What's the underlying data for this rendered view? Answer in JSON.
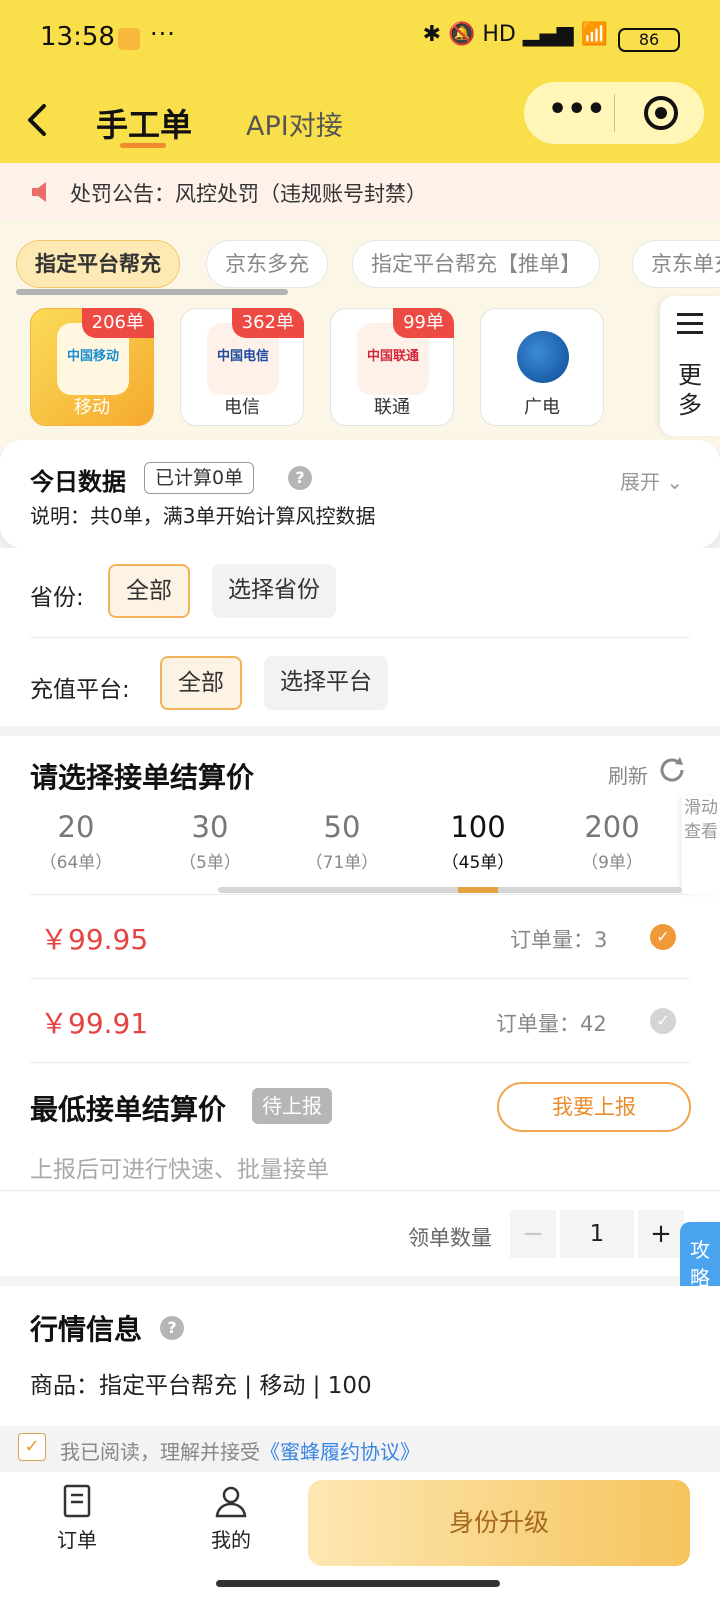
{
  "status": {
    "time": "13:58",
    "dots": "···",
    "icons_right": "✱ 🔕 HD ▂▄▆ 📶",
    "battery": "86"
  },
  "header": {
    "title": "手工单",
    "tab2": "API对接",
    "back_icon": "chevron-left-icon",
    "capsule_more": "•••"
  },
  "notice": {
    "text": "处罚公告：风控处罚（违规账号封禁）"
  },
  "chips": [
    {
      "label": "指定平台帮充",
      "active": true
    },
    {
      "label": "京东多充"
    },
    {
      "label": "指定平台帮充【推单】"
    },
    {
      "label": "京东单充"
    }
  ],
  "operators": [
    {
      "name": "移动",
      "badge": "206单",
      "logo_text": "中国移动",
      "color": "#1a8fd1"
    },
    {
      "name": "电信",
      "badge": "362单",
      "logo_text": "中国电信",
      "color": "#1c4a9e"
    },
    {
      "name": "联通",
      "badge": "99单",
      "logo_text": "中国联通",
      "color": "#d6283a"
    },
    {
      "name": "广电",
      "badge": ""
    }
  ],
  "more": {
    "label": "更多"
  },
  "stats": {
    "title": "今日数据",
    "badge": "已计算0单",
    "expand": "展开",
    "desc": "说明：共0单，满3单开始计算风控数据"
  },
  "filters": {
    "province_label": "省份:",
    "province_all": "全部",
    "province_select": "选择省份",
    "platform_label": "充值平台:",
    "platform_all": "全部",
    "platform_select": "选择平台"
  },
  "price": {
    "title": "请选择接单结算价",
    "refresh": "刷新",
    "slide_hint": "滑动查看",
    "denoms": [
      {
        "value": "20",
        "count": "（64单）"
      },
      {
        "value": "30",
        "count": "（5单）"
      },
      {
        "value": "50",
        "count": "（71单）"
      },
      {
        "value": "100",
        "count": "（45单）",
        "active": true
      },
      {
        "value": "200",
        "count": "（9单）"
      }
    ],
    "rows": [
      {
        "price": "￥99.95",
        "qty": "订单量：3",
        "selected": true
      },
      {
        "price": "￥99.91",
        "qty": "订单量：42",
        "selected": false
      }
    ]
  },
  "min_price": {
    "title": "最低接单结算价",
    "status": "待上报",
    "report_btn": "我要上报",
    "hint": "上报后可进行快速、批量接单"
  },
  "quantity": {
    "label": "领单数量",
    "value": "1",
    "minus": "−",
    "plus": "+"
  },
  "guide": {
    "label": "攻略",
    "arrow": "«"
  },
  "market": {
    "title": "行情信息",
    "goods": "商品：指定平台帮充 | 移动 | 100"
  },
  "agreement": {
    "checked": "✓",
    "text": "我已阅读，理解并接受",
    "link": "《蜜蜂履约协议》"
  },
  "bottom_nav": [
    {
      "label": "订单",
      "icon": "order-icon"
    },
    {
      "label": "我的",
      "icon": "person-icon"
    }
  ],
  "cta": {
    "label": "身份升级"
  },
  "colors": {
    "header": "#f9e04a",
    "accent": "#f0a64c",
    "price_red": "#e64343",
    "link_blue": "#3b86e2"
  }
}
